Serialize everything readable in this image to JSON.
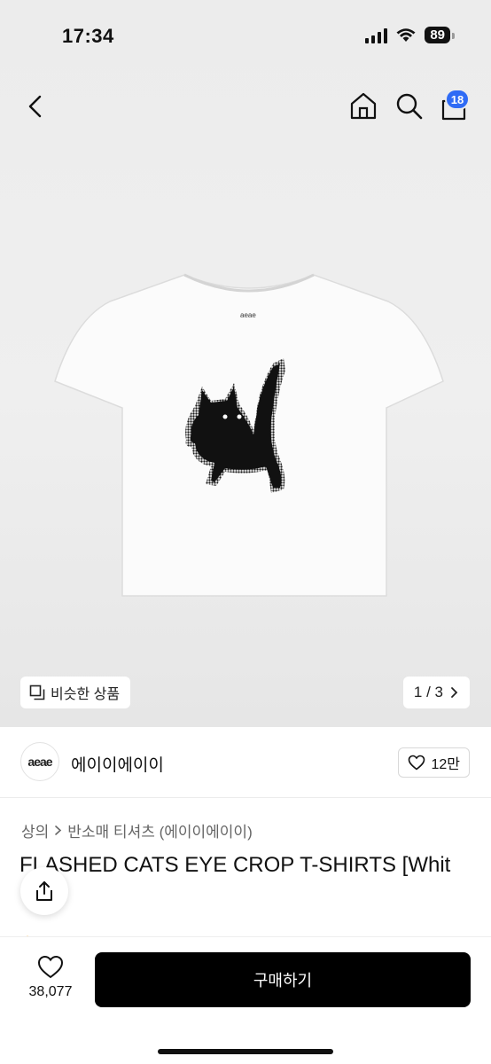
{
  "status_bar": {
    "time": "17:34",
    "battery": "89"
  },
  "header": {
    "cart_count": "18"
  },
  "gallery": {
    "similar_label": "비슷한 상품",
    "pager_text": "1 / 3",
    "garment_tag": "aeae"
  },
  "brand": {
    "logo_text": "aeae",
    "name": "에이이에이이",
    "likes": "12만"
  },
  "breadcrumb": {
    "category": "상의",
    "subcategory": "반소매 티셔츠 (에이이에이이)"
  },
  "product": {
    "title": "FLASHED CATS EYE CROP T-SHIRTS [Whit"
  },
  "bottom_bar": {
    "wish_count": "38,077",
    "buy_label": "구매하기"
  },
  "colors": {
    "accent": "#2f6bf5",
    "buy_button": "#000000",
    "background": "#ececec"
  }
}
